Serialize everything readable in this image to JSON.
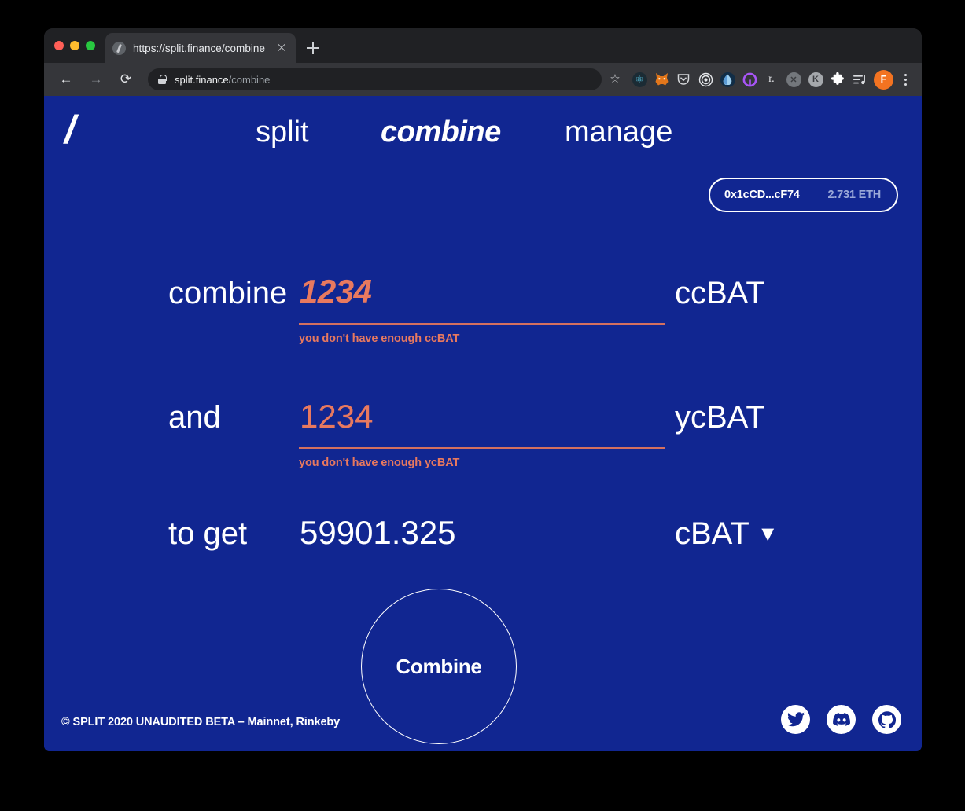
{
  "browser": {
    "tab": {
      "title": "https://split.finance/combine",
      "favicon": "split-slash-icon",
      "close": "close-icon"
    },
    "new_tab": "+",
    "nav": {
      "back": "←",
      "forward": "→",
      "reload": "⟳"
    },
    "url": {
      "domain": "split.finance",
      "path": "/combine",
      "lock": "lock-icon"
    },
    "star": "☆",
    "extensions": [
      {
        "name": "react-devtools-icon",
        "glyph": "⚛",
        "bg": "#1b2b34",
        "fg": "#61dafb"
      },
      {
        "name": "metamask-icon",
        "glyph": "🦊",
        "bg": "transparent",
        "fg": "#f6851b"
      },
      {
        "name": "pocket-icon",
        "glyph": "",
        "bg": "transparent",
        "fg": "#d5d7da"
      },
      {
        "name": "target-icon",
        "glyph": "◎",
        "bg": "transparent",
        "fg": "#e6e8eb"
      },
      {
        "name": "droplet-icon",
        "glyph": "",
        "bg": "#0d1b2a",
        "fg": "#7fb5e0"
      },
      {
        "name": "purple-ring-icon",
        "glyph": "",
        "bg": "transparent",
        "fg": "#a855f7"
      },
      {
        "name": "rarible-icon",
        "glyph": "r.",
        "bg": "transparent",
        "fg": "#e8eaed"
      },
      {
        "name": "x-circle-icon",
        "glyph": "✕",
        "bg": "#73777c",
        "fg": "#35363a"
      },
      {
        "name": "k-circle-icon",
        "glyph": "K",
        "bg": "#a5a8ac",
        "fg": "#35363a"
      },
      {
        "name": "puzzle-extensions-icon",
        "glyph": "🧩",
        "bg": "transparent",
        "fg": "#ffffff"
      },
      {
        "name": "playlist-icon",
        "glyph": "",
        "bg": "transparent",
        "fg": "#dadce0"
      }
    ],
    "profile": "F",
    "menu": "kebab-menu-icon"
  },
  "site": {
    "logo": "/",
    "nav": [
      {
        "id": "split",
        "label": "split",
        "active": false
      },
      {
        "id": "combine",
        "label": "combine",
        "active": true
      },
      {
        "id": "manage",
        "label": "manage",
        "active": false
      }
    ],
    "wallet": {
      "address": "0x1cCD...cF74",
      "balance": "2.731 ETH"
    },
    "form": {
      "rows": [
        {
          "label": "combine",
          "value": "1234",
          "token": "ccBAT",
          "error": "you don't have enough ccBAT",
          "state": "focused-error"
        },
        {
          "label": "and",
          "value": "1234",
          "token": "ycBAT",
          "error": "you don't have enough ycBAT",
          "state": "error"
        },
        {
          "label": "to get",
          "value": "59901.325",
          "token": "cBAT",
          "error": "",
          "state": "readonly-dropdown"
        }
      ],
      "dropdown_caret": "▼",
      "submit": "Combine"
    },
    "footer": {
      "copyright": "© SPLIT 2020 UNAUDITED BETA – Mainnet, Rinkeby",
      "socials": [
        {
          "name": "twitter-icon"
        },
        {
          "name": "discord-icon"
        },
        {
          "name": "github-icon"
        }
      ]
    },
    "colors": {
      "background": "#112691",
      "accent_error": "#e8795f",
      "text": "#ffffff",
      "wallet_balance": "#9aa8d8"
    }
  }
}
